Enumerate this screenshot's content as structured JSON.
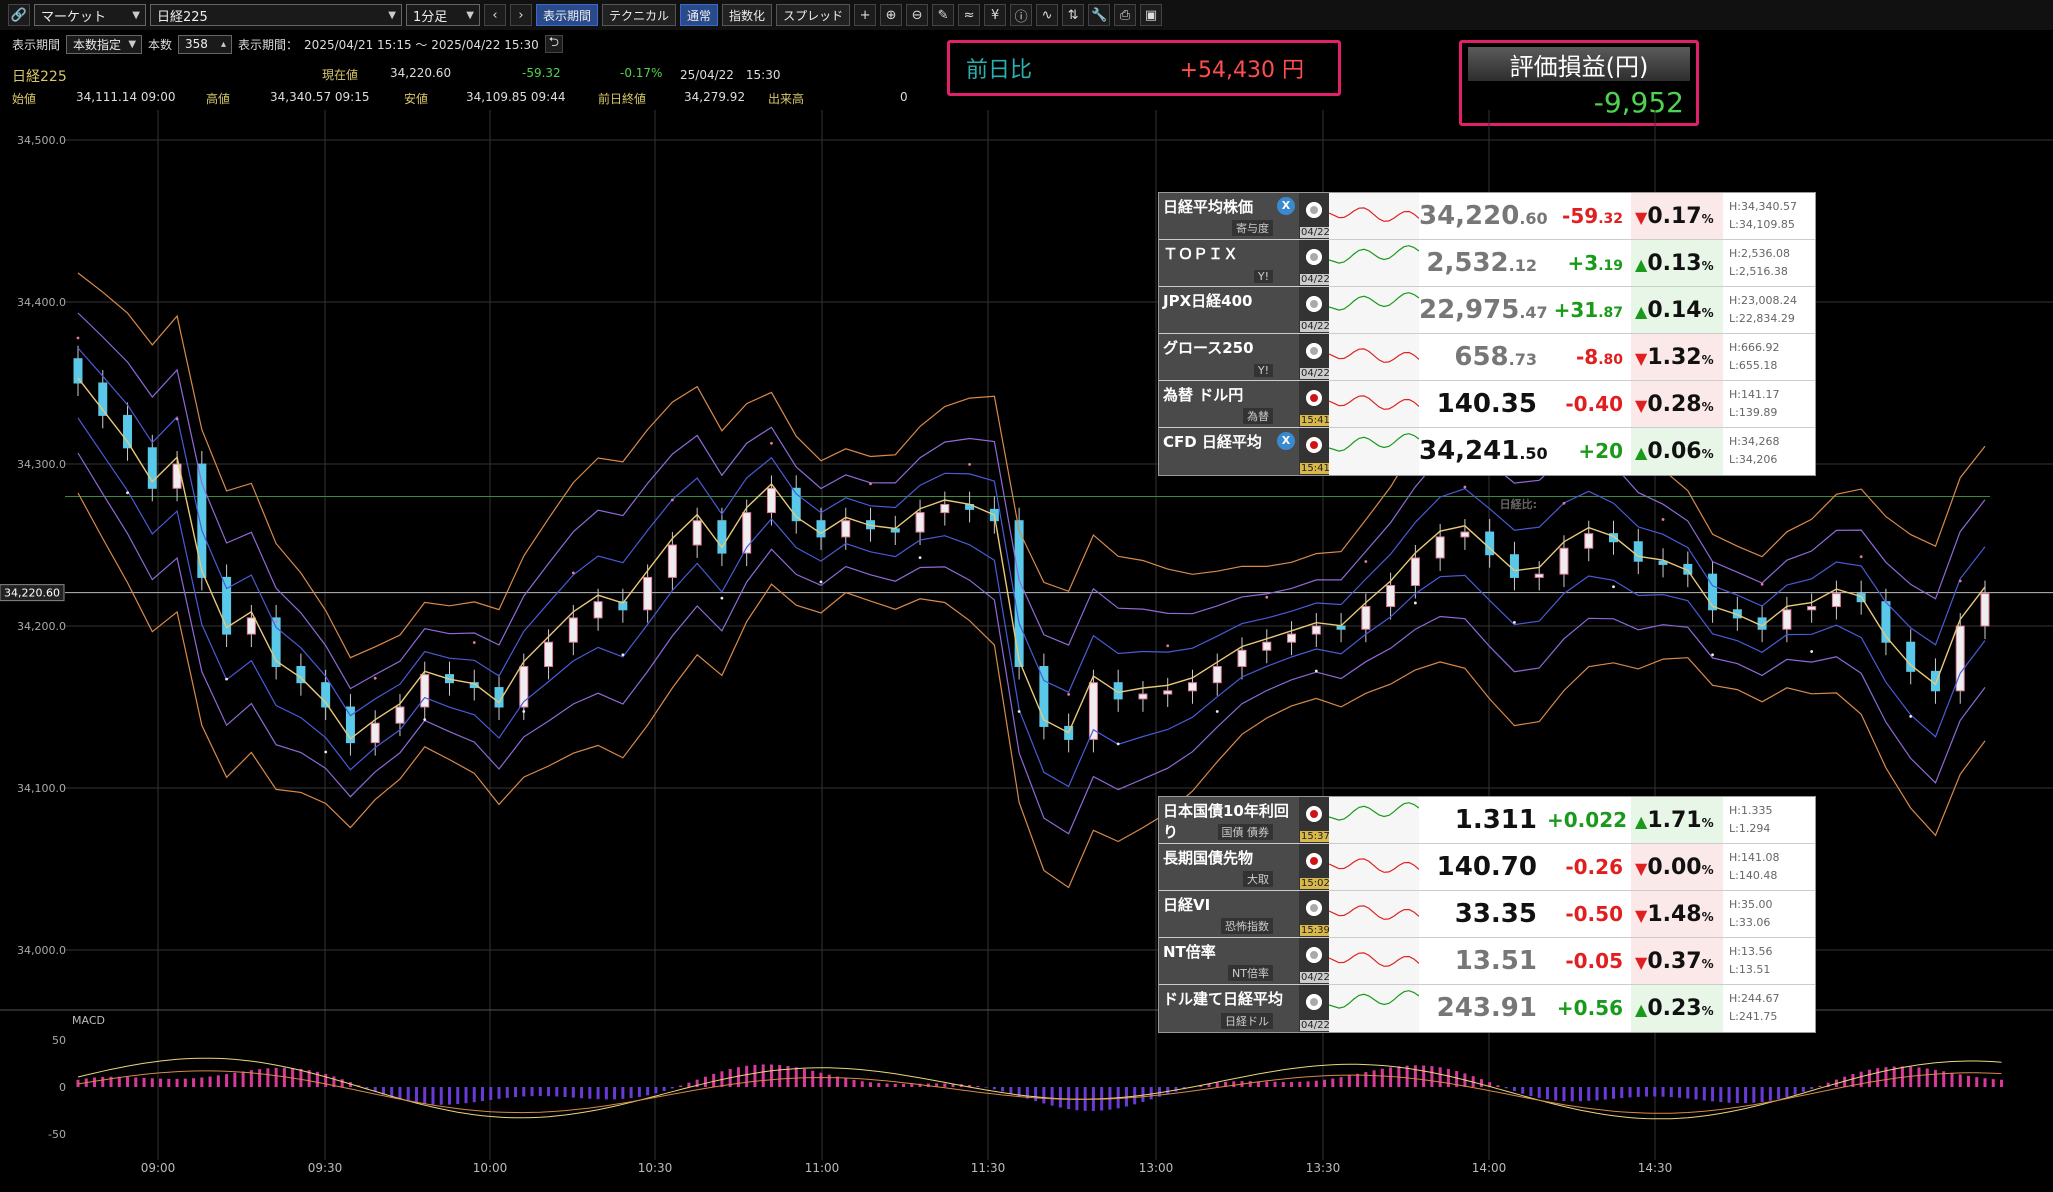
{
  "toolbar": {
    "market": "マーケット",
    "symbol": "日経225",
    "interval": "1分足",
    "btn_period": "表示期間",
    "btn_technical": "テクニカル",
    "btn_normal": "通常",
    "btn_index": "指数化",
    "btn_spread": "スプレッド"
  },
  "row2": {
    "label_period": "表示期間",
    "period_mode": "本数指定",
    "label_count": "本数",
    "count": "358",
    "label_display": "表示期間：",
    "range": "2025/04/21 15:15 ～ 2025/04/22 15:30"
  },
  "quote": {
    "name": "日経225",
    "cur_label": "現在値",
    "cur": "34,220.60",
    "chg": "-59.32",
    "pct": "-0.17%",
    "datetime": "25/04/22　15:30",
    "open_label": "始値",
    "open": "34,111.14  09:00",
    "high_label": "高値",
    "high": "34,340.57  09:15",
    "low_label": "安値",
    "low": "34,109.85  09:44",
    "prev_label": "前日終値",
    "prev": "34,279.92",
    "vol_label": "出来高",
    "vol": "0"
  },
  "overlay": {
    "diff_label": "前日比",
    "diff_value": "+54,430 円",
    "pl_label": "評価損益(円)",
    "pl_value": "-9,952"
  },
  "chart_data": {
    "type": "candlestick",
    "title": "",
    "y_ticks": [
      "34,500.0",
      "34,400.0",
      "34,300.0",
      "34,200.0",
      "34,100.0",
      "34,000.0"
    ],
    "y_range": [
      33985,
      34522
    ],
    "current_price_tag": "34,220.60",
    "x_ticks": [
      "09:00",
      "09:30",
      "10:00",
      "10:30",
      "11:00",
      "11:30",
      "13:00",
      "13:30",
      "14:00",
      "14:30"
    ],
    "macd_label": "MACD",
    "macd_ticks": [
      "50",
      "0",
      "-50"
    ],
    "horizontal_line": 34279.92,
    "close_series": [
      34350,
      34330,
      34310,
      34285,
      34300,
      34230,
      34195,
      34205,
      34175,
      34165,
      34150,
      34128,
      34140,
      34150,
      34170,
      34165,
      34162,
      34150,
      34175,
      34190,
      34205,
      34215,
      34210,
      34230,
      34250,
      34265,
      34245,
      34270,
      34285,
      34265,
      34255,
      34265,
      34260,
      34258,
      34270,
      34275,
      34272,
      34265,
      34175,
      34138,
      34130,
      34165,
      34155,
      34158,
      34160,
      34165,
      34175,
      34185,
      34190,
      34195,
      34200,
      34198,
      34212,
      34225,
      34242,
      34255,
      34258,
      34244,
      34230,
      34232,
      34248,
      34257,
      34252,
      34240,
      34238,
      34232,
      34210,
      34205,
      34198,
      34210,
      34212,
      34220,
      34215,
      34190,
      34172,
      34160,
      34200,
      34220
    ]
  },
  "watchlist_top": [
    {
      "name": "日経平均株価",
      "sub": "寄与度",
      "x": true,
      "time": "04/22",
      "flag": "gray",
      "price": "34,220",
      "dec": ".60",
      "chg": "-59",
      "cdec": ".32",
      "pct": "0.17",
      "dir": "down",
      "h": "H:34,340.57",
      "l": "L:34,109.85"
    },
    {
      "name": "ＴＯＰＩＸ",
      "sub": "Y!",
      "x": false,
      "time": "04/22",
      "flag": "gray",
      "price": "2,532",
      "dec": ".12",
      "chg": "+3",
      "cdec": ".19",
      "pct": "0.13",
      "dir": "up",
      "h": "H:2,536.08",
      "l": "L:2,516.38"
    },
    {
      "name": "JPX日経400",
      "sub": "",
      "x": false,
      "time": "04/22",
      "flag": "gray",
      "price": "22,975",
      "dec": ".47",
      "chg": "+31",
      "cdec": ".87",
      "pct": "0.14",
      "dir": "up",
      "h": "H:23,008.24",
      "l": "L:22,834.29"
    },
    {
      "name": "グロース250",
      "sub": "Y!",
      "x": false,
      "time": "04/22",
      "flag": "gray",
      "price": "658",
      "dec": ".73",
      "chg": "-8",
      "cdec": ".80",
      "pct": "1.32",
      "dir": "down",
      "h": "H:666.92",
      "l": "L:655.18"
    },
    {
      "name": "為替 ドル円",
      "sub": "為替",
      "x": false,
      "time": "15:41",
      "flag": "red",
      "price": "140.35",
      "dec": "",
      "chg": "-0.40",
      "cdec": "",
      "pct": "0.28",
      "dir": "down",
      "h": "H:141.17",
      "l": "L:139.89",
      "dark": true
    },
    {
      "name": "CFD 日経平均",
      "sub": "",
      "x": true,
      "time": "15:41",
      "flag": "red",
      "price": "34,241",
      "dec": ".50",
      "chg": "+20",
      "cdec": "",
      "pct": "0.06",
      "dir": "up",
      "h": "H:34,268",
      "l": "L:34,206",
      "dark": true,
      "cfd": "日経比:"
    }
  ],
  "watchlist_bottom": [
    {
      "name": "日本国債10年利回り",
      "sub": "国債 債券",
      "time": "15:37",
      "flag": "red",
      "price": "1.311",
      "chg": "+0.022",
      "pct": "1.71",
      "dir": "up",
      "h": "H:1.335",
      "l": "L:1.294",
      "dark": true
    },
    {
      "name": "長期国債先物",
      "sub": "大取",
      "time": "15:02",
      "flag": "red",
      "price": "140.70",
      "chg": "-0.26",
      "pct": "0.00",
      "dir": "down",
      "h": "H:141.08",
      "l": "L:140.48",
      "dark": true
    },
    {
      "name": "日経VI",
      "sub": "恐怖指数",
      "time": "15:39",
      "flag": "face",
      "price": "33.35",
      "chg": "-0.50",
      "pct": "1.48",
      "dir": "down",
      "h": "H:35.00",
      "l": "L:33.06",
      "dark": true
    },
    {
      "name": "NT倍率",
      "sub": "NT倍率",
      "time": "04/22",
      "flag": "gray",
      "price": "13.51",
      "chg": "-0.05",
      "pct": "0.37",
      "dir": "down",
      "h": "H:13.56",
      "l": "L:13.51"
    },
    {
      "name": "ドル建て日経平均",
      "sub": "日経ドル",
      "time": "04/22",
      "flag": "gray",
      "price": "243.91",
      "chg": "+0.56",
      "pct": "0.23",
      "dir": "up",
      "h": "H:244.67",
      "l": "L:241.75"
    }
  ]
}
